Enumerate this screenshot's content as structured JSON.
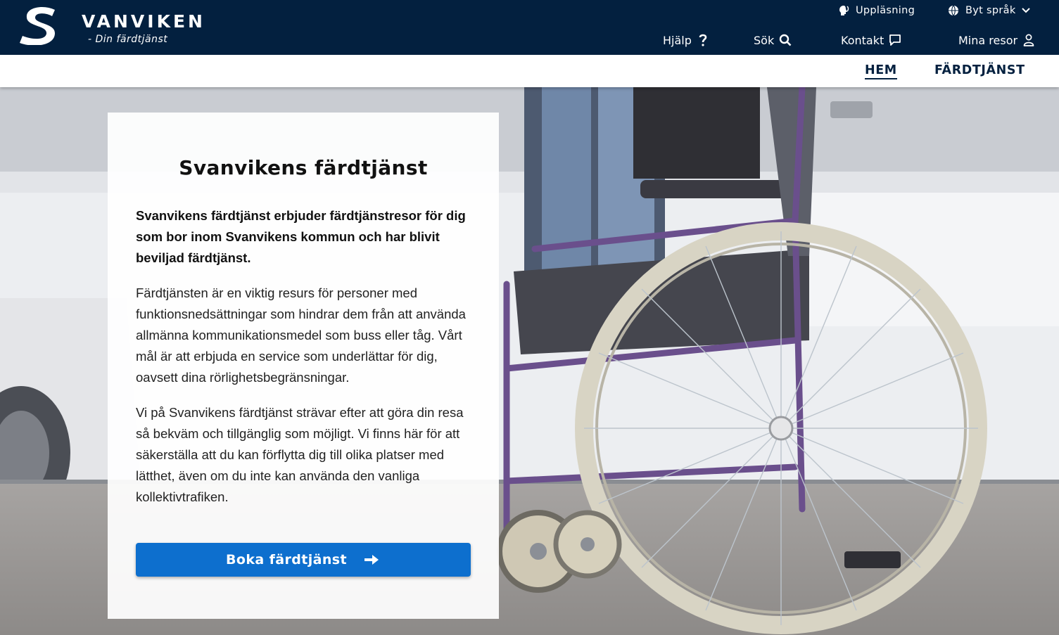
{
  "brand": {
    "name": "VANVIKEN",
    "tagline": "- Din färdtjänst"
  },
  "utility": {
    "read_aloud": "Uppläsning",
    "language": "Byt språk"
  },
  "main_nav": {
    "help": "Hjälp",
    "search": "Sök",
    "contact": "Kontakt",
    "my_trips": "Mina resor"
  },
  "sub_nav": {
    "home": "HEM",
    "service": "FÄRDTJÄNST"
  },
  "card": {
    "title": "Svanvikens färdtjänst",
    "lead": "Svanvikens färdtjänst erbjuder färdtjänstresor för dig som bor inom Svanvikens kommun och har blivit beviljad färdtjänst.",
    "paragraph_2": "Färdtjänsten är en viktig resurs för personer med funktionsnedsättningar som hindrar dem från att använda allmänna kommunikationsmedel som buss eller tåg. Vårt mål är att erbjuda en service som underlättar för dig, oavsett dina rörlighetsbegränsningar.",
    "paragraph_3": "Vi på Svanvikens färdtjänst strävar efter att göra din resa så bekväm och tillgänglig som möjligt. Vi finns här för att säkerställa att du kan förflytta dig till olika platser med lätthet, även om du inte kan använda den vanliga kollektivtrafiken.",
    "cta_label": "Boka färdtjänst"
  },
  "colors": {
    "header_bg": "#03203f",
    "cta_bg": "#0d6fce",
    "wheelchair_frame": "#6a4f8c"
  },
  "icons": {
    "read_aloud": "speaker-head-icon",
    "language": "globe-icon",
    "help": "question-icon",
    "search": "search-icon",
    "contact": "chat-icon",
    "my_trips": "user-icon",
    "cta": "arrow-right-icon"
  }
}
